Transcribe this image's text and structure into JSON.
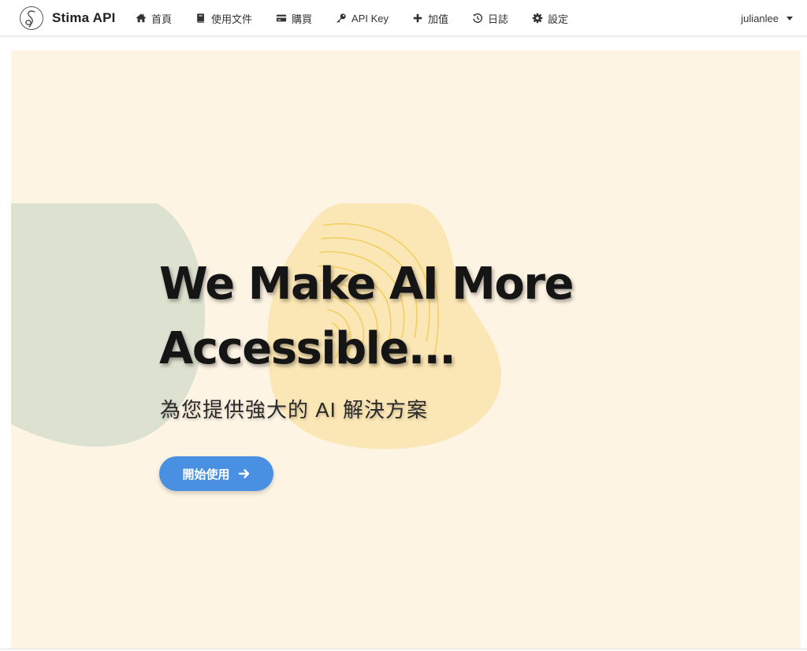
{
  "brand": {
    "name": "Stima API",
    "logo_icon": "stima-signature-logo"
  },
  "nav": {
    "items": [
      {
        "label": "首頁",
        "icon": "home-icon"
      },
      {
        "label": "使用文件",
        "icon": "book-icon"
      },
      {
        "label": "購買",
        "icon": "credit-card-icon"
      },
      {
        "label": "API Key",
        "icon": "key-icon"
      },
      {
        "label": "加值",
        "icon": "plus-icon"
      },
      {
        "label": "日誌",
        "icon": "history-icon"
      },
      {
        "label": "設定",
        "icon": "gear-icon"
      }
    ]
  },
  "user": {
    "name": "julianlee"
  },
  "hero": {
    "headline_line1": "We Make AI More",
    "headline_line2": "Accessible...",
    "subtitle": "為您提供強大的 AI 解決方案",
    "cta_label": "開始使用",
    "cta_icon": "arrow-right-icon"
  },
  "colors": {
    "hero_background": "#fef4e4",
    "green_blob": "#dde1cf",
    "yellow_blob": "#fbe6b5",
    "yellow_lines": "#f2cf63",
    "cta_background": "#4a90e2",
    "headline_text": "#151515"
  }
}
